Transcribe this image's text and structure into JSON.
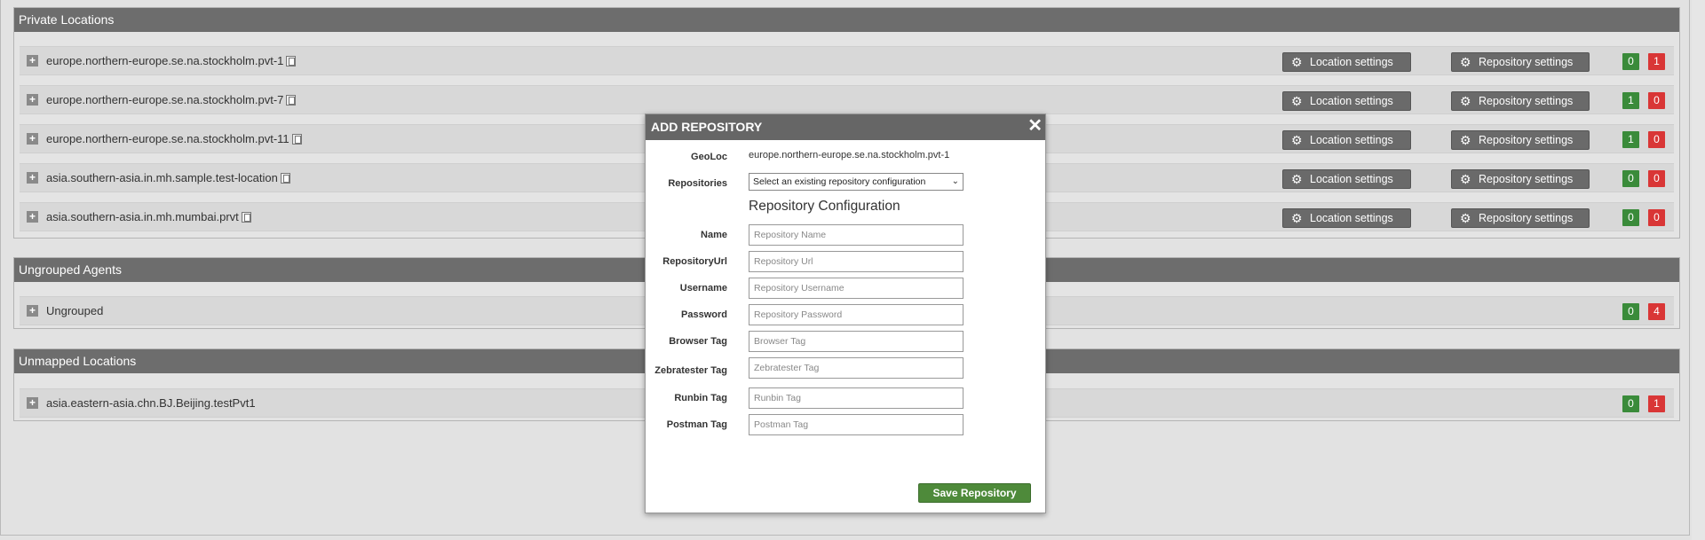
{
  "sections": {
    "private": {
      "title": "Private Locations",
      "rows": [
        {
          "name": "europe.northern-europe.se.na.stockholm.pvt-1",
          "green": "0",
          "red": "1"
        },
        {
          "name": "europe.northern-europe.se.na.stockholm.pvt-7",
          "green": "1",
          "red": "0"
        },
        {
          "name": "europe.northern-europe.se.na.stockholm.pvt-11",
          "green": "1",
          "red": "0"
        },
        {
          "name": "asia.southern-asia.in.mh.sample.test-location",
          "green": "0",
          "red": "0"
        },
        {
          "name": "asia.southern-asia.in.mh.mumbai.prvt",
          "green": "0",
          "red": "0"
        }
      ],
      "location_settings_label": "Location settings",
      "repository_settings_label": "Repository settings"
    },
    "ungrouped": {
      "title": "Ungrouped Agents",
      "rows": [
        {
          "name": "Ungrouped",
          "green": "0",
          "red": "4"
        }
      ]
    },
    "unmapped": {
      "title": "Unmapped Locations",
      "rows": [
        {
          "name": "asia.eastern-asia.chn.BJ.Beijing.testPvt1",
          "green": "0",
          "red": "1"
        }
      ]
    }
  },
  "colors": {
    "header": "#6d6d6d",
    "green": "#3a8b3a",
    "red": "#d93636",
    "save": "#4e8a3a"
  },
  "modal": {
    "title": "ADD REPOSITORY",
    "close_glyph": "✕",
    "geoloc_label": "GeoLoc",
    "geoloc_value": "europe.northern-europe.se.na.stockholm.pvt-1",
    "repositories_label": "Repositories",
    "repositories_select": "Select an existing repository configuration",
    "config_title": "Repository Configuration",
    "fields": [
      {
        "label": "Name",
        "placeholder": "Repository Name"
      },
      {
        "label": "RepositoryUrl",
        "placeholder": "Repository Url"
      },
      {
        "label": "Username",
        "placeholder": "Repository Username"
      },
      {
        "label": "Password",
        "placeholder": "Repository Password"
      },
      {
        "label": "Browser Tag",
        "placeholder": "Browser Tag"
      },
      {
        "label": "Zebratester Tag",
        "placeholder": "Zebratester Tag"
      },
      {
        "label": "Runbin Tag",
        "placeholder": "Runbin Tag"
      },
      {
        "label": "Postman Tag",
        "placeholder": "Postman Tag"
      }
    ],
    "save_label": "Save Repository"
  },
  "icons": {
    "expand": "plus-icon",
    "copy": "copy-icon",
    "gear": "gear-icon",
    "close": "close-icon",
    "select": "chevron-down-icon"
  }
}
